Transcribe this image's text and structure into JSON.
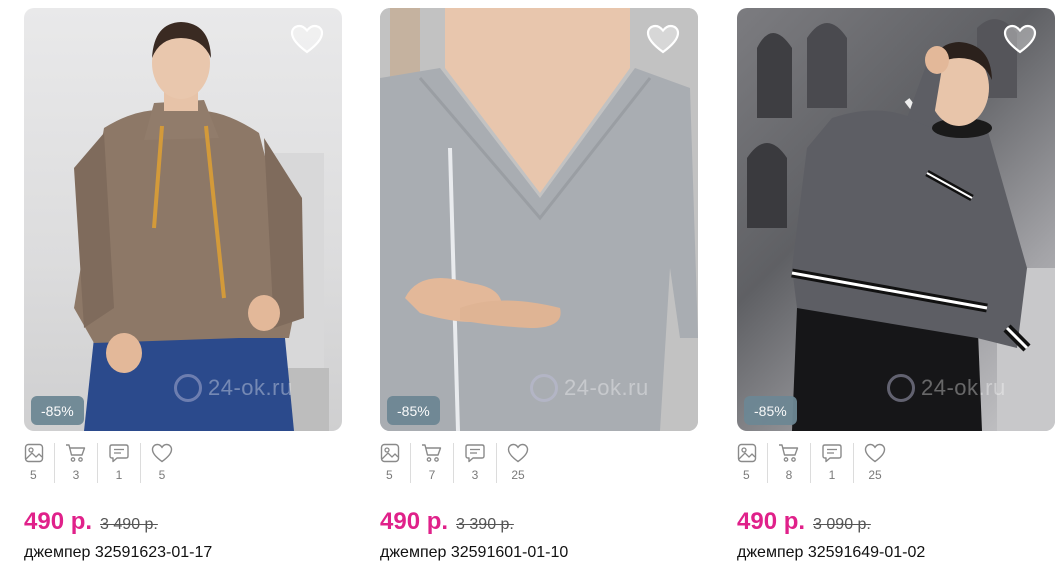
{
  "products": [
    {
      "discount": "-85%",
      "watermark": "24-ok.ru",
      "stats": {
        "photos": "5",
        "cart": "3",
        "comments": "1",
        "likes": "5"
      },
      "price": "490 р.",
      "old_price": "3 490 р.",
      "title": "джемпер 32591623-01-17"
    },
    {
      "discount": "-85%",
      "watermark": "24-ok.ru",
      "stats": {
        "photos": "5",
        "cart": "7",
        "comments": "3",
        "likes": "25"
      },
      "price": "490 р.",
      "old_price": "3 390 р.",
      "title": "джемпер 32591601-01-10"
    },
    {
      "discount": "-85%",
      "watermark": "24-ok.ru",
      "stats": {
        "photos": "5",
        "cart": "8",
        "comments": "1",
        "likes": "25"
      },
      "price": "490 р.",
      "old_price": "3 090 р.",
      "title": "джемпер 32591649-01-02"
    }
  ],
  "colors": {
    "price": "#e0218a",
    "discount_badge": "#6d8794"
  }
}
